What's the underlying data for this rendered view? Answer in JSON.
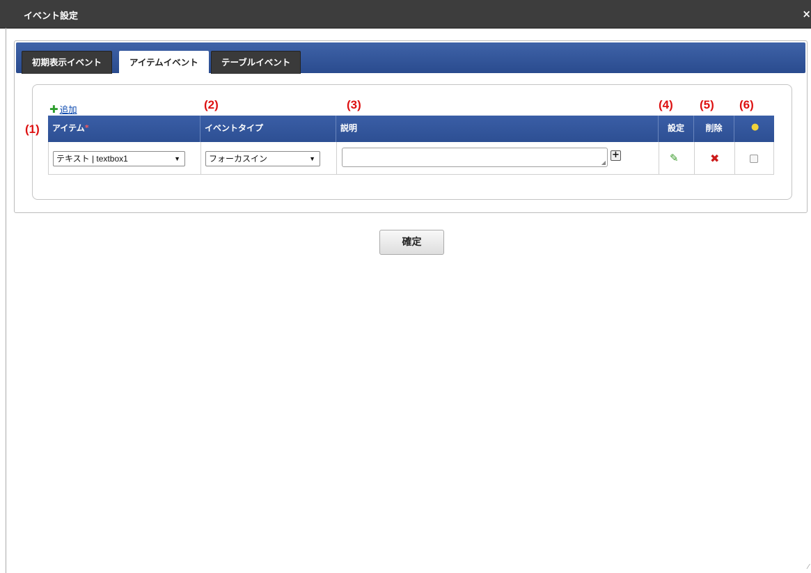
{
  "window": {
    "title": "イベント設定",
    "close_glyph": "×"
  },
  "tabs": [
    {
      "label": "初期表示イベント",
      "active": false
    },
    {
      "label": "アイテムイベント",
      "active": true
    },
    {
      "label": "テーブルイベント",
      "active": false
    }
  ],
  "grid": {
    "add_label": "追加",
    "columns": {
      "item": "アイテム",
      "event_type": "イベントタイプ",
      "description": "説明",
      "settings": "設定",
      "delete": "削除"
    },
    "required_mark": "*",
    "row": {
      "item_value": "テキスト | textbox1",
      "event_type_value": "フォーカスイン",
      "description_value": "",
      "expand_glyph": "+"
    }
  },
  "annotations": [
    "(1)",
    "(2)",
    "(3)",
    "(4)",
    "(5)",
    "(6)"
  ],
  "buttons": {
    "confirm": "確定"
  },
  "icons": {
    "add": "plus-icon",
    "settings": "pencil-icon",
    "delete": "x-icon",
    "hint": "lightbulb-icon",
    "dropdown": "chevron-down-icon"
  },
  "colors": {
    "titlebar": "#3d3d3d",
    "tabstrip": "#2d4f93",
    "annotation": "#dd1111",
    "pencil": "#3a9b2a",
    "delete": "#cc1a1a"
  }
}
